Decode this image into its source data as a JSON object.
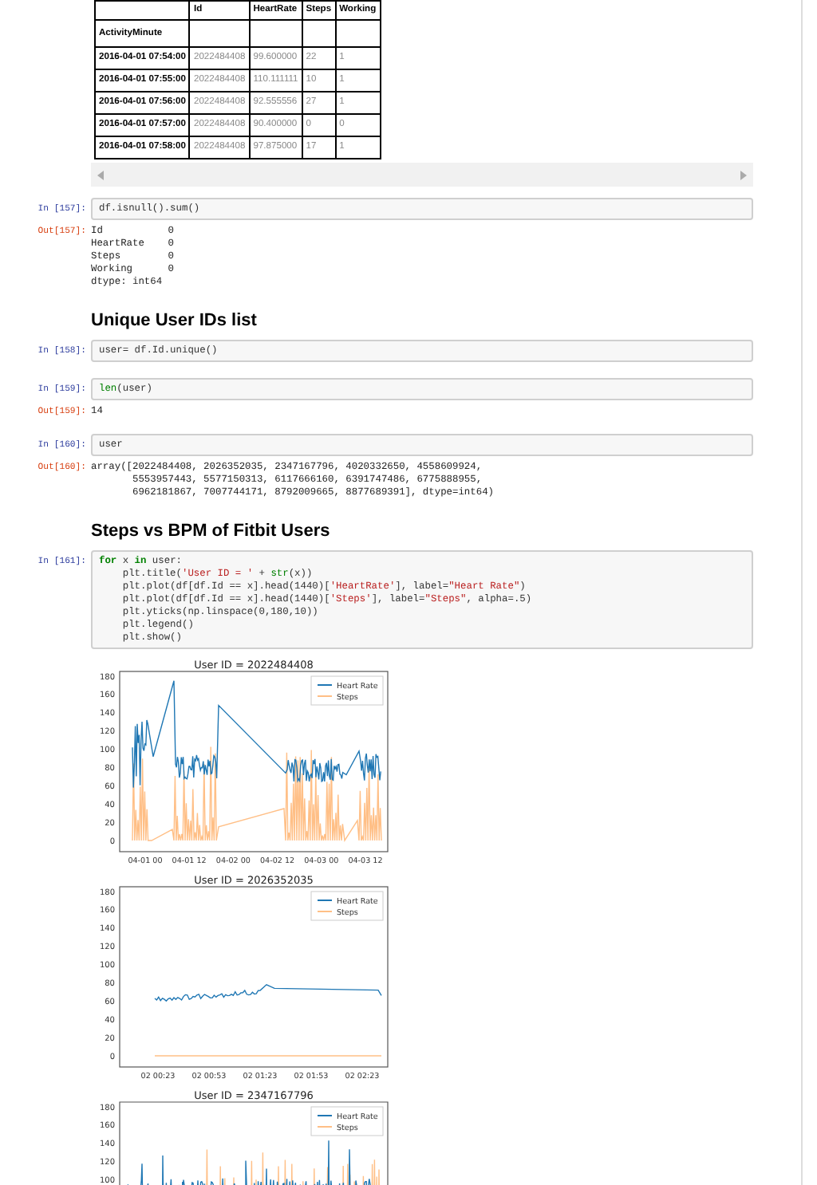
{
  "table": {
    "columns": [
      "",
      "Id",
      "HeartRate",
      "Steps",
      "Working"
    ],
    "index_name": "ActivityMinute",
    "rows": [
      [
        "2016-04-01 07:54:00",
        "2022484408",
        "99.600000",
        "22",
        "1"
      ],
      [
        "2016-04-01 07:55:00",
        "2022484408",
        "110.111111",
        "10",
        "1"
      ],
      [
        "2016-04-01 07:56:00",
        "2022484408",
        "92.555556",
        "27",
        "1"
      ],
      [
        "2016-04-01 07:57:00",
        "2022484408",
        "90.400000",
        "0",
        "0"
      ],
      [
        "2016-04-01 07:58:00",
        "2022484408",
        "97.875000",
        "17",
        "1"
      ]
    ]
  },
  "cells": [
    {
      "kind": "code",
      "prompt": "In [157]:",
      "lines": [
        [
          {
            "t": "df.isnull().sum()",
            "kind": "plain"
          }
        ]
      ]
    },
    {
      "kind": "output",
      "prompt": "Out[157]:",
      "lines": [
        "Id           0",
        "HeartRate    0",
        "Steps        0",
        "Working      0",
        "dtype: int64"
      ]
    },
    {
      "kind": "heading",
      "text": "Unique User IDs list"
    },
    {
      "kind": "code",
      "prompt": "In [158]:",
      "lines": [
        [
          {
            "t": "user= df.Id.unique()",
            "kind": "plain"
          }
        ]
      ]
    },
    {
      "kind": "code",
      "prompt": "In [159]:",
      "lines": [
        [
          {
            "t": "len",
            "kind": "builtin"
          },
          {
            "t": "(user)",
            "kind": "plain"
          }
        ]
      ]
    },
    {
      "kind": "output",
      "prompt": "Out[159]:",
      "lines": [
        "14"
      ]
    },
    {
      "kind": "code",
      "prompt": "In [160]:",
      "lines": [
        [
          {
            "t": "user",
            "kind": "plain"
          }
        ]
      ]
    },
    {
      "kind": "output",
      "prompt": "Out[160]:",
      "lines": [
        "array([2022484408, 2026352035, 2347167796, 4020332650, 4558609924,",
        "       5553957443, 5577150313, 6117666160, 6391747486, 6775888955,",
        "       6962181867, 7007744171, 8792009665, 8877689391], dtype=int64)"
      ]
    },
    {
      "kind": "heading",
      "text": "Steps vs BPM of Fitbit Users"
    },
    {
      "kind": "code",
      "prompt": "In [161]:",
      "lines": [
        [
          {
            "t": "for",
            "kind": "keyword"
          },
          {
            "t": " x ",
            "kind": "plain"
          },
          {
            "t": "in",
            "kind": "keyword"
          },
          {
            "t": " user:",
            "kind": "plain"
          }
        ],
        [
          {
            "t": "    plt.title(",
            "kind": "plain"
          },
          {
            "t": "'User ID = '",
            "kind": "string"
          },
          {
            "t": " + ",
            "kind": "plain"
          },
          {
            "t": "str",
            "kind": "builtin"
          },
          {
            "t": "(x))",
            "kind": "plain"
          }
        ],
        [
          {
            "t": "    plt.plot(df[df.Id == x].head(1440)[",
            "kind": "plain"
          },
          {
            "t": "'HeartRate'",
            "kind": "string"
          },
          {
            "t": "], label=",
            "kind": "plain"
          },
          {
            "t": "\"Heart Rate\"",
            "kind": "string"
          },
          {
            "t": ")",
            "kind": "plain"
          }
        ],
        [
          {
            "t": "    plt.plot(df[df.Id == x].head(1440)[",
            "kind": "plain"
          },
          {
            "t": "'Steps'",
            "kind": "string"
          },
          {
            "t": "], label=",
            "kind": "plain"
          },
          {
            "t": "\"Steps\"",
            "kind": "string"
          },
          {
            "t": ", alpha=.5)",
            "kind": "plain"
          }
        ],
        [
          {
            "t": "    plt.yticks(np.linspace(0,180,10))",
            "kind": "plain"
          }
        ],
        [
          {
            "t": "    plt.legend()",
            "kind": "plain"
          }
        ],
        [
          {
            "t": "    plt.show()",
            "kind": "plain"
          }
        ]
      ]
    },
    {
      "kind": "plots",
      "charts": [
        {
          "title": "User ID = 2022484408",
          "yticks": [
            "180",
            "160",
            "140",
            "120",
            "100",
            "80",
            "60",
            "40",
            "20",
            "0"
          ],
          "xticks": [
            "04-01 00",
            "04-01 12",
            "04-02 00",
            "04-02 12",
            "04-03 00",
            "04-03 12"
          ],
          "legend": [
            "Heart Rate",
            "Steps"
          ]
        },
        {
          "title": "User ID = 2026352035",
          "yticks": [
            "180",
            "160",
            "140",
            "120",
            "100",
            "80",
            "60",
            "40",
            "20",
            "0"
          ],
          "xticks": [
            "02 00:23",
            "02 00:53",
            "02 01:23",
            "02 01:53",
            "02 02:23"
          ],
          "legend": [
            "Heart Rate",
            "Steps"
          ]
        },
        {
          "title": "User ID = 2347167796",
          "yticks": [
            "180",
            "160",
            "140",
            "120",
            "100"
          ],
          "legend": [
            "Heart Rate",
            "Steps"
          ]
        }
      ]
    }
  ]
}
